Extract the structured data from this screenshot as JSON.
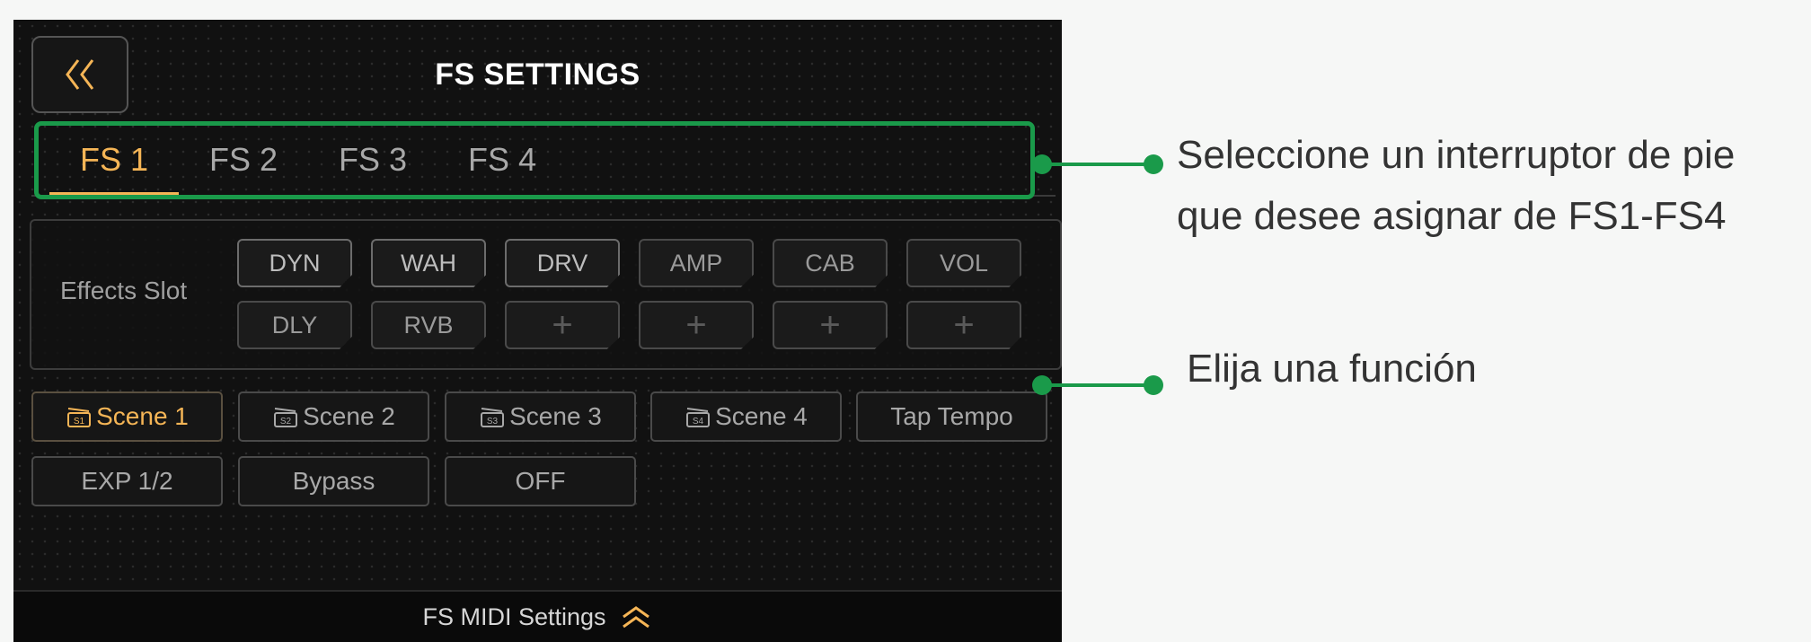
{
  "header": {
    "title": "FS SETTINGS",
    "back_icon": "double-chevron-left-icon"
  },
  "tabs": [
    {
      "label": "FS 1",
      "active": true
    },
    {
      "label": "FS 2",
      "active": false
    },
    {
      "label": "FS 3",
      "active": false
    },
    {
      "label": "FS 4",
      "active": false
    }
  ],
  "effects": {
    "label": "Effects Slot",
    "row1": [
      "DYN",
      "WAH",
      "DRV",
      "AMP",
      "CAB",
      "VOL"
    ],
    "row2": [
      "DLY",
      "RVB",
      "+",
      "+",
      "+",
      "+"
    ]
  },
  "functions": {
    "row1": [
      "Scene 1",
      "Scene 2",
      "Scene 3",
      "Scene 4",
      "Tap Tempo"
    ],
    "row2": [
      "EXP 1/2",
      "Bypass",
      "OFF"
    ]
  },
  "footer": {
    "label": "FS MIDI Settings",
    "icon": "double-chevron-up-icon"
  },
  "annotations": {
    "footswitch_line1": "Seleccione un interruptor de pie",
    "footswitch_line2": "que desee asignar de FS1-FS4",
    "function": "Elija una función"
  },
  "colors": {
    "accent": "#f5b556",
    "callout": "#1a9a4a",
    "background": "#111111"
  }
}
